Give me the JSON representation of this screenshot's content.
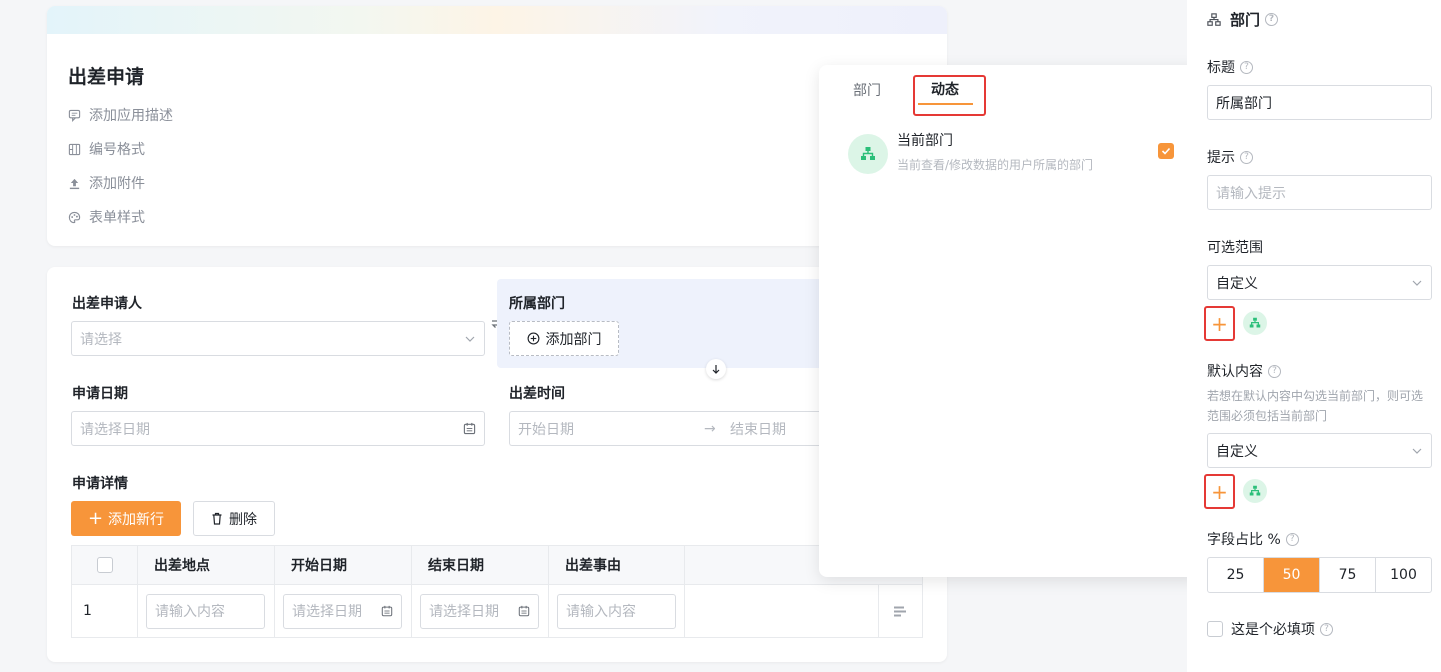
{
  "header": {
    "title": "出差申请",
    "links": [
      {
        "label": "添加应用描述",
        "icon": "comment-icon"
      },
      {
        "label": "编号格式",
        "icon": "number-format-icon"
      },
      {
        "label": "添加附件",
        "icon": "upload-icon"
      },
      {
        "label": "表单样式",
        "icon": "palette-icon"
      }
    ]
  },
  "form": {
    "applicant_label": "出差申请人",
    "applicant_placeholder": "请选择",
    "department_label": "所属部门",
    "add_department": "添加部门",
    "date_label": "申请日期",
    "date_placeholder": "请选择日期",
    "trip_time_label": "出差时间",
    "start_placeholder": "开始日期",
    "end_placeholder": "结束日期",
    "details_label": "申请详情",
    "add_row": "添加新行",
    "delete": "删除",
    "columns": [
      "出差地点",
      "开始日期",
      "结束日期",
      "出差事由"
    ],
    "row": {
      "index": "1",
      "location_placeholder": "请输入内容",
      "start_placeholder": "请选择日期",
      "end_placeholder": "请选择日期",
      "reason_placeholder": "请输入内容"
    }
  },
  "popover": {
    "tabs": [
      "部门",
      "动态"
    ],
    "active_tab": "动态",
    "item_title": "当前部门",
    "item_desc": "当前查看/修改数据的用户所属的部门"
  },
  "panel": {
    "title": "部门",
    "title_label": "标题",
    "title_value": "所属部门",
    "hint_label": "提示",
    "hint_placeholder": "请输入提示",
    "range_label": "可选范围",
    "range_value": "自定义",
    "default_label": "默认内容",
    "default_note": "若想在默认内容中勾选当前部门，则可选范围必须包括当前部门",
    "default_value": "自定义",
    "ratio_label": "字段占比 %",
    "ratio_options": [
      "25",
      "50",
      "75",
      "100"
    ],
    "ratio_selected": "50",
    "required_label": "这是个必填项"
  },
  "colors": {
    "accent": "#f7953a",
    "green": "#2bbf7a",
    "highlight_red": "#e53935",
    "selected_field_bg": "#eef2fc"
  }
}
